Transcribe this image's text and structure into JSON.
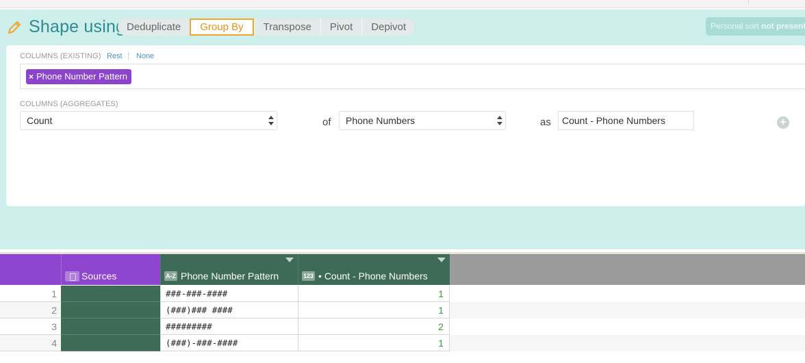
{
  "header": {
    "title": "Shape using",
    "tabs": [
      {
        "label": "Deduplicate",
        "active": false
      },
      {
        "label": "Group By",
        "active": true
      },
      {
        "label": "Transpose",
        "active": false
      },
      {
        "label": "Pivot",
        "active": false
      },
      {
        "label": "Depivot",
        "active": false
      }
    ],
    "personal_sort_prefix": "Personal sort",
    "personal_sort_bold": "not present"
  },
  "form": {
    "columns_existing_label": "COLUMNS (EXISTING)",
    "rest_link": "Rest",
    "separator": "|",
    "none_link": "None",
    "selected_columns": [
      {
        "label": "Phone Number Pattern",
        "remove_icon": "×"
      }
    ],
    "columns_aggregates_label": "COLUMNS (AGGREGATES)",
    "aggregate_function": "Count",
    "of_label": "of",
    "aggregate_column": "Phone Numbers",
    "as_label": "as",
    "output_name": "Count - Phone Numbers",
    "add_icon": "+"
  },
  "grid": {
    "columns": [
      {
        "label": "Sources",
        "type_badge": ""
      },
      {
        "label": "Phone Number Pattern",
        "type_badge": "A-Z"
      },
      {
        "label": "• Count - Phone Numbers",
        "type_badge": "123"
      }
    ],
    "rows": [
      {
        "index": "1",
        "pattern": "###-###-####",
        "count": "1"
      },
      {
        "index": "2",
        "pattern": "(###)### ####",
        "count": "1"
      },
      {
        "index": "3",
        "pattern": "#########",
        "count": "2"
      },
      {
        "index": "4",
        "pattern": "(###)-###-####",
        "count": "1"
      }
    ]
  },
  "colors": {
    "accent_teal": "#2d8c93",
    "panel_bg": "#cdeeea",
    "active_tab": "#f0a530",
    "pill_purple": "#8c44cd",
    "header_green": "#3e6b58",
    "count_green": "#3c9a3c"
  }
}
